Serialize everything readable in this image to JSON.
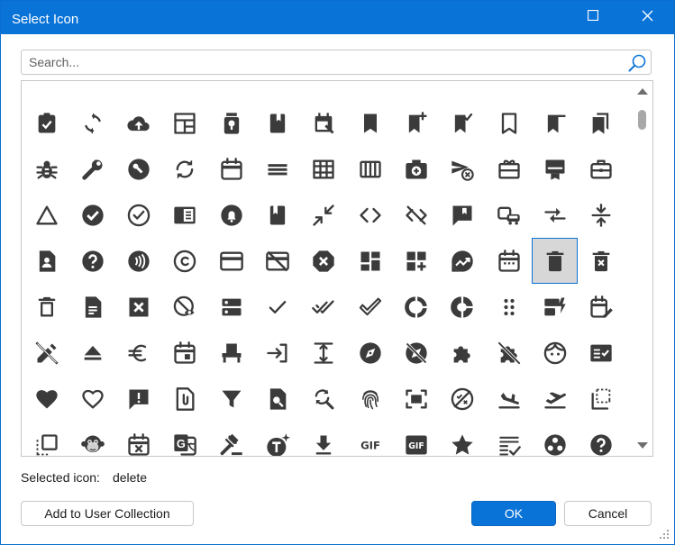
{
  "window": {
    "title": "Select Icon"
  },
  "search": {
    "placeholder": "Search..."
  },
  "icons": [
    [
      "partial-top-icon",
      "partial-top-icon",
      "partial-top-icon",
      "partial-top-icon",
      "partial-top-icon",
      "partial-top-icon",
      "partial-top-icon",
      "partial-top-icon",
      "partial-top-icon",
      "partial-top-icon",
      "partial-top-icon",
      "partial-top-icon",
      "partial-top-icon"
    ],
    [
      "assignment-turned-in-icon",
      "autorenew-icon",
      "cloud-upload-icon",
      "dashboard-layout-icon",
      "lightbulb-jar-icon",
      "book-icon",
      "event-edit-icon",
      "bookmark-icon",
      "bookmark-add-icon",
      "bookmark-added-icon",
      "bookmark-border-icon",
      "bookmark-remove-icon",
      "bookmarks-icon"
    ],
    [
      "bug-report-icon",
      "build-icon",
      "build-circle-icon",
      "sync-icon",
      "calendar-icon",
      "menu-lines-icon",
      "table-grid-icon",
      "view-column-icon",
      "add-a-photo-icon",
      "cancel-schedule-send-icon",
      "card-giftcard-icon",
      "card-membership-icon",
      "business-center-icon"
    ],
    [
      "change-history-icon",
      "check-circle-icon",
      "check-circle-outline-icon",
      "chrome-reader-mode-icon",
      "notification-circle-icon",
      "class-book-icon",
      "close-fullscreen-icon",
      "code-icon",
      "code-off-icon",
      "comment-bank-icon",
      "commute-icon",
      "compare-arrows-icon",
      "compress-icon"
    ],
    [
      "contact-page-icon",
      "help-icon",
      "contactless-icon",
      "copyright-icon",
      "credit-card-icon",
      "credit-card-off-icon",
      "dangerous-icon",
      "dashboard-icon",
      "dashboard-customize-icon",
      "data-exploration-icon",
      "date-range-icon",
      "delete-icon",
      "delete-forever-icon"
    ],
    [
      "delete-outline-icon",
      "description-icon",
      "disabled-by-default-icon",
      "disabled-visible-icon",
      "dns-icon",
      "done-icon",
      "done-all-icon",
      "done-outline-icon",
      "donut-large-icon",
      "donut-small-icon",
      "drag-indicator-icon",
      "dynamic-form-icon",
      "edit-calendar-icon"
    ],
    [
      "edit-off-icon",
      "eject-icon",
      "euro-symbol-icon",
      "event-icon",
      "event-seat-icon",
      "exit-to-app-icon",
      "expand-icon",
      "explore-icon",
      "explore-off-icon",
      "extension-icon",
      "extension-off-icon",
      "face-icon",
      "fact-check-icon"
    ],
    [
      "favorite-icon",
      "favorite-border-icon",
      "feedback-icon",
      "file-present-icon",
      "filter-alt-icon",
      "find-in-page-icon",
      "find-replace-icon",
      "fingerprint-icon",
      "fit-screen-icon",
      "flaky-icon",
      "flight-land-icon",
      "flight-takeoff-icon",
      "flip-to-back-icon"
    ],
    [
      "flip-to-front-icon",
      "monkey-face-icon",
      "free-cancellation-icon",
      "g-translate-icon",
      "gavel-icon",
      "text-sparkle-icon",
      "get-app-icon",
      "gif-icon",
      "gif-box-icon",
      "grade-icon",
      "grading-icon",
      "group-work-icon",
      "help-center-icon"
    ]
  ],
  "selection": {
    "label": "Selected icon:",
    "value": "delete"
  },
  "buttons": {
    "add_collection": "Add to User Collection",
    "ok": "OK",
    "cancel": "Cancel"
  },
  "colors": {
    "accent": "#0a73d8",
    "icon": "#3b3b3b",
    "selected_bg": "#d7d7d7"
  }
}
